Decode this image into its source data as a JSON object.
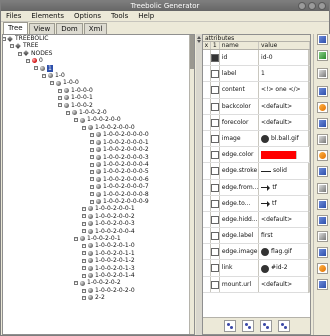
{
  "window": {
    "title": "Treebolic Generator"
  },
  "menu": {
    "items": [
      "Files",
      "Elements",
      "Options",
      "Tools",
      "Help"
    ]
  },
  "tabs": [
    {
      "label": "Tree",
      "active": true
    },
    {
      "label": "View",
      "active": false
    },
    {
      "label": "Dom",
      "active": false
    },
    {
      "label": "Xml",
      "active": false
    }
  ],
  "tree": {
    "rows": [
      {
        "label": "TREEBOLIC",
        "level": 0,
        "type": "diamond"
      },
      {
        "label": "TREE",
        "level": 1,
        "type": "diamond"
      },
      {
        "label": "NODES",
        "level": 2,
        "type": "diamond"
      },
      {
        "label": "0",
        "level": 3,
        "type": "red"
      },
      {
        "label": "1",
        "level": 4,
        "type": "selected"
      },
      {
        "label": "1-0",
        "level": 5,
        "type": "node"
      },
      {
        "label": "1-0-0",
        "level": 6,
        "type": "node"
      },
      {
        "label": "1-0-0-0",
        "level": 7,
        "type": "node"
      },
      {
        "label": "1-0-0-1",
        "level": 7,
        "type": "node"
      },
      {
        "label": "1-0-0-2",
        "level": 7,
        "type": "node"
      },
      {
        "label": "1-0-0-2-0",
        "level": 8,
        "type": "node"
      },
      {
        "label": "1-0-0-2-0-0",
        "level": 9,
        "type": "node"
      },
      {
        "label": "1-0-0-2-0-0-0",
        "level": 10,
        "type": "node"
      },
      {
        "label": "1-0-0-2-0-0-0-0",
        "level": 11,
        "type": "node"
      },
      {
        "label": "1-0-0-2-0-0-0-1",
        "level": 11,
        "type": "node"
      },
      {
        "label": "1-0-0-2-0-0-0-2",
        "level": 11,
        "type": "node"
      },
      {
        "label": "1-0-0-2-0-0-0-3",
        "level": 11,
        "type": "node"
      },
      {
        "label": "1-0-0-2-0-0-0-4",
        "level": 11,
        "type": "node"
      },
      {
        "label": "1-0-0-2-0-0-0-5",
        "level": 11,
        "type": "node"
      },
      {
        "label": "1-0-0-2-0-0-0-6",
        "level": 11,
        "type": "node"
      },
      {
        "label": "1-0-0-2-0-0-0-7",
        "level": 11,
        "type": "node"
      },
      {
        "label": "1-0-0-2-0-0-0-8",
        "level": 11,
        "type": "node"
      },
      {
        "label": "1-0-0-2-0-0-0-9",
        "level": 11,
        "type": "node"
      },
      {
        "label": "1-0-0-2-0-0-1",
        "level": 10,
        "type": "node"
      },
      {
        "label": "1-0-0-2-0-0-2",
        "level": 10,
        "type": "node"
      },
      {
        "label": "1-0-0-2-0-0-3",
        "level": 10,
        "type": "node"
      },
      {
        "label": "1-0-0-2-0-0-4",
        "level": 10,
        "type": "node"
      },
      {
        "label": "1-0-0-2-0-1",
        "level": 9,
        "type": "node"
      },
      {
        "label": "1-0-0-2-0-1-0",
        "level": 10,
        "type": "node"
      },
      {
        "label": "1-0-0-2-0-1-1",
        "level": 10,
        "type": "node"
      },
      {
        "label": "1-0-0-2-0-1-2",
        "level": 10,
        "type": "node"
      },
      {
        "label": "1-0-0-2-0-1-3",
        "level": 10,
        "type": "node"
      },
      {
        "label": "1-0-0-2-0-1-4",
        "level": 10,
        "type": "node"
      },
      {
        "label": "1-0-0-2-0-2",
        "level": 9,
        "type": "node"
      },
      {
        "label": "1-0-0-2-0-2-0",
        "level": 10,
        "type": "node"
      },
      {
        "label": "2-2",
        "level": 10,
        "type": "node"
      }
    ]
  },
  "attributes": {
    "panel_title": "attributes",
    "header": {
      "x": "x",
      "i": "1",
      "name": "name",
      "value": "value"
    },
    "rows": [
      {
        "name": "id",
        "value": "id-0"
      },
      {
        "name": "label",
        "value": "1"
      },
      {
        "name": "content",
        "value": "<!> one </>"
      },
      {
        "name": "backcolor",
        "value": "<default>"
      },
      {
        "name": "forecolor",
        "value": "<default>"
      },
      {
        "name": "image",
        "value": "bl.ball.gif"
      },
      {
        "name": "edge.color",
        "value": ""
      },
      {
        "name": "edge.stroke",
        "value": "solid"
      },
      {
        "name": "edge.from...",
        "value": "tf"
      },
      {
        "name": "edge.to...",
        "value": "tf"
      },
      {
        "name": "edge.hidd...",
        "value": "<default>"
      },
      {
        "name": "edge.label",
        "value": "first"
      },
      {
        "name": "edge.image",
        "value": "flag.gif"
      },
      {
        "name": "link",
        "value": "#id-2"
      },
      {
        "name": "mount.url",
        "value": "<default>"
      }
    ]
  },
  "colors": {
    "edge_color_swatch": "#ff0000",
    "selection_blue": "#2d4fab",
    "red_node": "#cc0000"
  },
  "icons": {
    "node": "node-icon",
    "selected_node": "selected-node-icon",
    "expand": "expand-icon"
  }
}
